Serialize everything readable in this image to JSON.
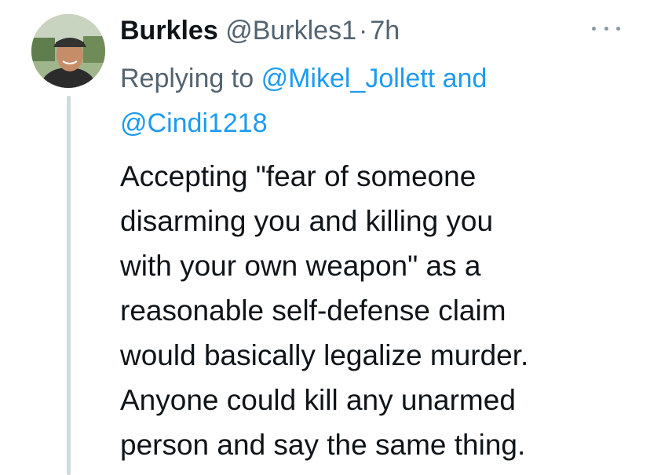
{
  "tweet": {
    "display_name": "Burkles",
    "handle": "@Burkles1",
    "separator": "·",
    "time": "7h",
    "reply": {
      "prefix": "Replying to",
      "mentions": [
        "@Mikel_Jollett",
        "@Cindi1218"
      ],
      "joiner": "and"
    },
    "body_lines": [
      "Accepting \"fear of someone",
      "disarming you and killing you",
      "with your own weapon\" as a",
      "reasonable self-defense claim",
      "would basically legalize murder.",
      "Anyone could kill any unarmed",
      "person and say the same thing."
    ]
  },
  "icons": {
    "avatar": "profile-photo",
    "more": "more-horizontal-icon"
  },
  "colors": {
    "text": "#0f1419",
    "secondary": "#536471",
    "link": "#1d9bf0",
    "thread_line": "#cfd9de"
  }
}
